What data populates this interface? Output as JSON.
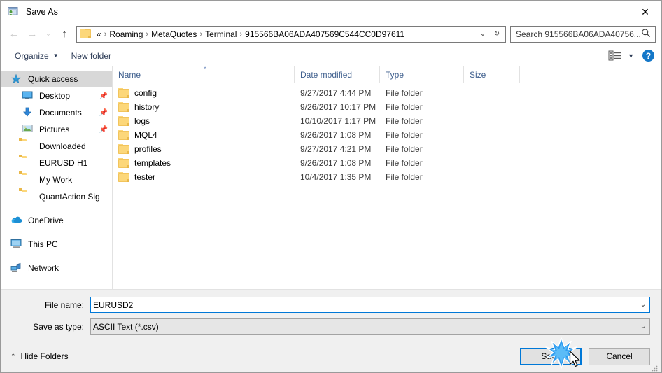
{
  "window": {
    "title": "Save As",
    "icon": "app-icon",
    "close_label": "✕"
  },
  "nav": {
    "back_icon": "←",
    "forward_icon": "→",
    "recent_icon": "⌄",
    "up_icon": "↑",
    "address": {
      "overflow": "«",
      "crumbs": [
        "Roaming",
        "MetaQuotes",
        "Terminal",
        "915566BA06ADA407569C544CC0D97611"
      ],
      "separator": "›",
      "dropdown_icon": "⌄",
      "refresh_icon": "↻"
    },
    "search": {
      "placeholder": "Search 915566BA06ADA40756...",
      "icon": "search-icon"
    }
  },
  "toolbar": {
    "organize_label": "Organize",
    "organize_caret": "▼",
    "new_folder_label": "New folder",
    "view_caret": "▼",
    "help_label": "?"
  },
  "sidebar": {
    "items": [
      {
        "label": "Quick access",
        "icon": "star-icon",
        "selected": true,
        "indent": false,
        "pin": ""
      },
      {
        "label": "Desktop",
        "icon": "desktop-icon",
        "selected": false,
        "indent": true,
        "pin": "📌"
      },
      {
        "label": "Documents",
        "icon": "documents-icon",
        "selected": false,
        "indent": true,
        "pin": "📌"
      },
      {
        "label": "Pictures",
        "icon": "pictures-icon",
        "selected": false,
        "indent": true,
        "pin": "📌"
      },
      {
        "label": "Downloaded",
        "icon": "folder-icon",
        "selected": false,
        "indent": true,
        "pin": ""
      },
      {
        "label": "EURUSD H1",
        "icon": "folder-icon",
        "selected": false,
        "indent": true,
        "pin": ""
      },
      {
        "label": "My Work",
        "icon": "folder-icon",
        "selected": false,
        "indent": true,
        "pin": ""
      },
      {
        "label": "QuantAction Signal",
        "icon": "folder-icon",
        "selected": false,
        "indent": true,
        "pin": ""
      },
      {
        "label": "OneDrive",
        "icon": "onedrive-icon",
        "selected": false,
        "indent": false,
        "pin": "",
        "gap_before": true
      },
      {
        "label": "This PC",
        "icon": "thispc-icon",
        "selected": false,
        "indent": false,
        "pin": "",
        "gap_before": true
      },
      {
        "label": "Network",
        "icon": "network-icon",
        "selected": false,
        "indent": false,
        "pin": "",
        "gap_before": true
      }
    ]
  },
  "filelist": {
    "columns": [
      "Name",
      "Date modified",
      "Type",
      "Size"
    ],
    "sort_indicator": "^",
    "rows": [
      {
        "name": "config",
        "date": "9/27/2017 4:44 PM",
        "type": "File folder",
        "size": ""
      },
      {
        "name": "history",
        "date": "9/26/2017 10:17 PM",
        "type": "File folder",
        "size": ""
      },
      {
        "name": "logs",
        "date": "10/10/2017 1:17 PM",
        "type": "File folder",
        "size": ""
      },
      {
        "name": "MQL4",
        "date": "9/26/2017 1:08 PM",
        "type": "File folder",
        "size": ""
      },
      {
        "name": "profiles",
        "date": "9/27/2017 4:21 PM",
        "type": "File folder",
        "size": ""
      },
      {
        "name": "templates",
        "date": "9/26/2017 1:08 PM",
        "type": "File folder",
        "size": ""
      },
      {
        "name": "tester",
        "date": "10/4/2017 1:35 PM",
        "type": "File folder",
        "size": ""
      }
    ]
  },
  "footer": {
    "filename_label": "File name:",
    "filename_value": "EURUSD2",
    "filetype_label": "Save as type:",
    "filetype_value": "ASCII Text (*.csv)",
    "dropdown_icon": "⌄"
  },
  "buttons": {
    "hide_folders_label": "Hide Folders",
    "hide_folders_chev": "⌃",
    "save_label": "Save",
    "cancel_label": "Cancel"
  },
  "colors": {
    "accent": "#0078d7",
    "folder": "#fcd77a",
    "selection": "#0a78d4",
    "header_text": "#41618f",
    "help_blue": "#1477c8"
  }
}
